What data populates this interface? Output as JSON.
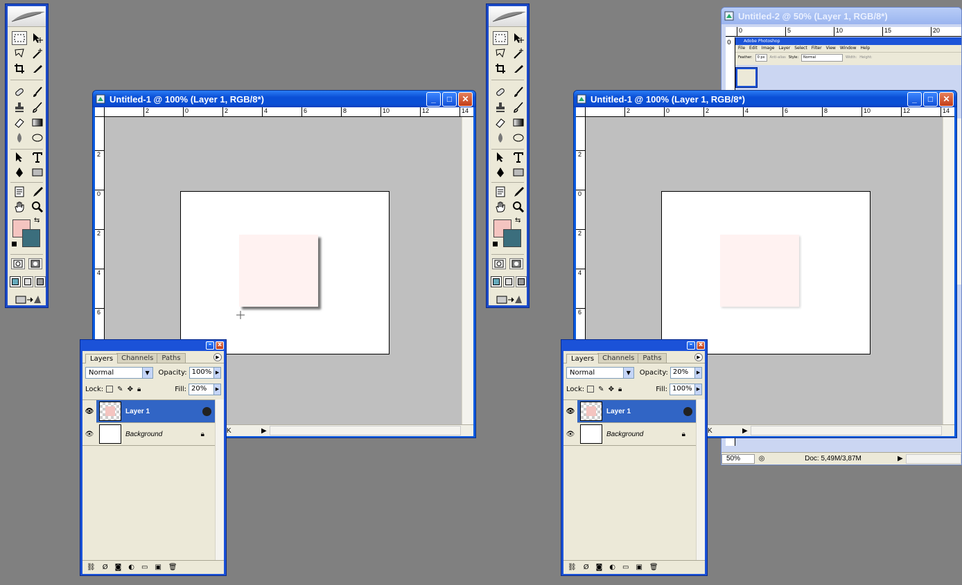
{
  "left": {
    "doc_title": "Untitled-1 @ 100% (Layer 1, RGB/8*)",
    "ruler_top": [
      "2",
      "0",
      "2",
      "4",
      "6",
      "8",
      "10",
      "12",
      "14"
    ],
    "ruler_left": [
      "2",
      "0",
      "2",
      "4",
      "6"
    ],
    "status_text": "K",
    "layers": {
      "tabs": [
        "Layers",
        "Channels",
        "Paths"
      ],
      "blend_mode": "Normal",
      "opacity_label": "Opacity:",
      "opacity": "100%",
      "lock_label": "Lock:",
      "fill_label": "Fill:",
      "fill": "20%",
      "items": [
        {
          "name": "Layer 1"
        },
        {
          "name": "Background"
        }
      ]
    }
  },
  "right": {
    "doc_title": "Untitled-1 @ 100% (Layer 1, RGB/8*)",
    "ruler_top": [
      "2",
      "0",
      "2",
      "4",
      "6",
      "8",
      "10",
      "12",
      "14"
    ],
    "ruler_left": [
      "2",
      "0",
      "2",
      "4",
      "6"
    ],
    "status_text": "K",
    "layers": {
      "tabs": [
        "Layers",
        "Channels",
        "Paths"
      ],
      "blend_mode": "Normal",
      "opacity_label": "Opacity:",
      "opacity": "20%",
      "lock_label": "Lock:",
      "fill_label": "Fill:",
      "fill": "100%",
      "items": [
        {
          "name": "Layer 1"
        },
        {
          "name": "Background"
        }
      ]
    }
  },
  "back_window": {
    "title": "Untitled-2 @ 50% (Layer 1, RGB/8*)",
    "ruler_top": [
      "0",
      "5",
      "10",
      "15",
      "20"
    ],
    "inner_app_title": "Adobe Photoshop",
    "inner_menu": [
      "File",
      "Edit",
      "Image",
      "Layer",
      "Select",
      "Filter",
      "View",
      "Window",
      "Help"
    ],
    "inner_options": {
      "feather_label": "Feather:",
      "feather": "0 px",
      "antialias": "Anti-alias",
      "style_label": "Style:",
      "style": "Normal",
      "width_label": "Width:",
      "height_label": "Height:"
    },
    "zoom": "50%",
    "doc_size": "Doc: 5,49M/3,87M"
  },
  "colors": {
    "foreground": "#f4c4c0",
    "background": "#3b6e7d",
    "selection": "#3165c5",
    "desktop": "#808080"
  }
}
